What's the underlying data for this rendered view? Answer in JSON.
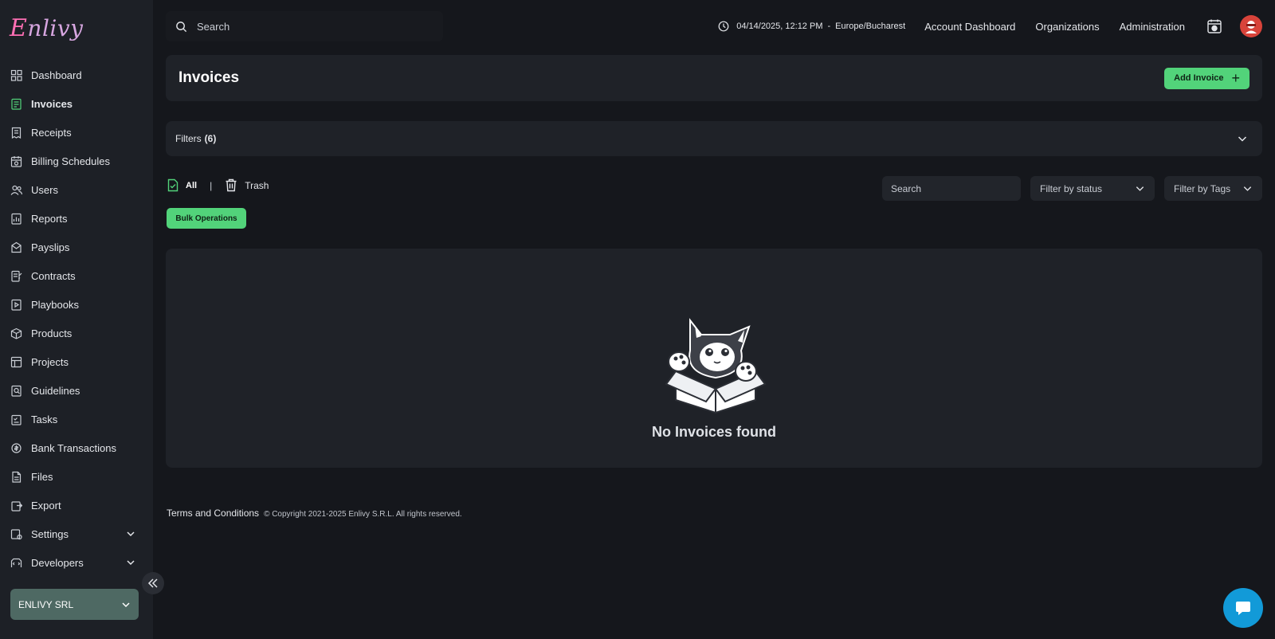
{
  "app": {
    "logo_text": "Enlivy"
  },
  "sidebar": {
    "items": [
      {
        "label": "Dashboard",
        "icon": "dashboard-icon"
      },
      {
        "label": "Invoices",
        "icon": "invoice-icon",
        "active": true
      },
      {
        "label": "Receipts",
        "icon": "receipt-icon"
      },
      {
        "label": "Billing Schedules",
        "icon": "billing-schedule-icon"
      },
      {
        "label": "Users",
        "icon": "users-icon"
      },
      {
        "label": "Reports",
        "icon": "reports-icon"
      },
      {
        "label": "Payslips",
        "icon": "payslip-icon"
      },
      {
        "label": "Contracts",
        "icon": "contract-icon"
      },
      {
        "label": "Playbooks",
        "icon": "playbook-icon"
      },
      {
        "label": "Products",
        "icon": "product-box-icon"
      },
      {
        "label": "Projects",
        "icon": "projects-icon"
      },
      {
        "label": "Guidelines",
        "icon": "guidelines-icon"
      },
      {
        "label": "Tasks",
        "icon": "tasks-icon"
      },
      {
        "label": "Bank Transactions",
        "icon": "bank-transaction-icon"
      },
      {
        "label": "Files",
        "icon": "file-icon"
      },
      {
        "label": "Export",
        "icon": "export-icon"
      },
      {
        "label": "Settings",
        "icon": "settings-icon",
        "expandable": true
      },
      {
        "label": "Developers",
        "icon": "developers-icon",
        "expandable": true
      }
    ],
    "organization": "ENLIVY SRL"
  },
  "topbar": {
    "search_placeholder": "Search",
    "datetime": "04/14/2025, 12:12 PM",
    "separator": "-",
    "timezone": "Europe/Bucharest",
    "links": [
      "Account Dashboard",
      "Organizations",
      "Administration"
    ]
  },
  "page": {
    "title": "Invoices",
    "add_button": "Add Invoice",
    "filters_label": "Filters",
    "filters_count": "(6)",
    "tab_all": "All",
    "tab_separator": "|",
    "tab_trash": "Trash",
    "bulk_button": "Bulk Operations",
    "search_placeholder": "Search",
    "filter_status": "Filter by status",
    "filter_tags": "Filter by Tags",
    "empty_message": "No Invoices found"
  },
  "footer": {
    "terms": "Terms and Conditions",
    "copyright": "© Copyright 2021-2025 Enlivy S.R.L. All rights reserved."
  },
  "colors": {
    "background": "#15171c",
    "sidebar": "#1d2026",
    "card": "#1f2228",
    "accent_green": "#52d37a",
    "org_select": "#4e6963",
    "chat": "#129ad8"
  }
}
